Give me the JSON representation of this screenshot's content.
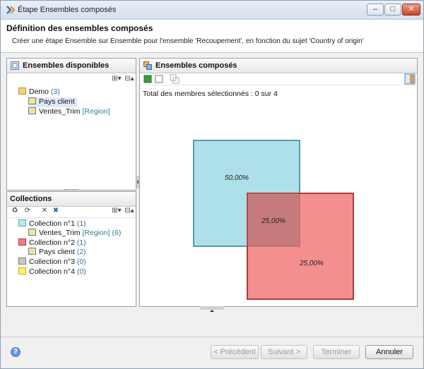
{
  "window": {
    "title": "Étape Ensembles composés",
    "min": "–",
    "max": "□",
    "close": "✕"
  },
  "header": {
    "title": "Définition des ensembles composés",
    "subtitle": "Créer une étape Ensemble sur Ensemble pour l'ensemble 'Recoupement', en fonction du sujet 'Country of origin'"
  },
  "available": {
    "heading": "Ensembles disponibles",
    "expand": "⊞▾",
    "collapse": "⊟▴",
    "root": {
      "label": "Demo",
      "count": "(3)"
    },
    "items": [
      {
        "label": "Pays client",
        "tag": ""
      },
      {
        "label": "Ventes_Trim",
        "tag": "[Region]"
      }
    ]
  },
  "collections": {
    "heading": "Collections",
    "expand": "⊞▾",
    "collapse": "⊟▴",
    "items": [
      {
        "label": "Collection n°1",
        "count": "(1)",
        "color": "#bde7ee",
        "border": "#5aa8b8"
      },
      {
        "label": "Collection n°2",
        "count": "(1)",
        "color": "#f08080",
        "border": "#b03030"
      },
      {
        "label": "Collection n°3",
        "count": "(0)",
        "color": "#c8c8c8",
        "border": "#7a7a7a"
      },
      {
        "label": "Collection n°4",
        "count": "(0)",
        "color": "#fff07a",
        "border": "#c8b000"
      }
    ],
    "children": [
      {
        "label": "Ventes_Trim",
        "tag": "[Region]",
        "count": "(6)"
      },
      {
        "label": "Pays client",
        "count": "(2)"
      }
    ]
  },
  "composed": {
    "heading": "Ensembles composés",
    "total": "Total des membres sélectionnés : 0 sur 4",
    "venn": {
      "a_only": "50,00%",
      "both": "25,00%",
      "b_only": "25,00%"
    }
  },
  "buttons": {
    "help": "?",
    "previous": "< Précédent",
    "next": "Suivant >",
    "finish": "Terminer",
    "cancel": "Annuler"
  }
}
